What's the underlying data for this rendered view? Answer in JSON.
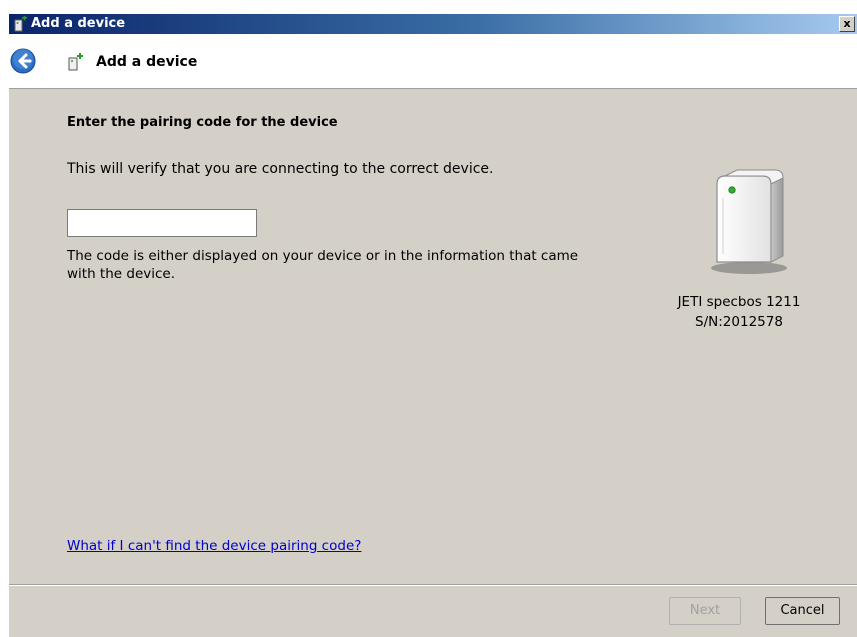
{
  "window": {
    "title": "Add a device",
    "close_label": "x"
  },
  "header": {
    "title": "Add a device"
  },
  "content": {
    "heading": "Enter the pairing code for the device",
    "description": "This will verify that you are connecting to the correct device.",
    "pairing_code_value": "",
    "hint": "The code is either displayed on your device or in the information that came with the device.",
    "help_link": "What if I can't find the device pairing code?"
  },
  "device": {
    "name": "JETI specbos 1211",
    "serial": "S/N:2012578",
    "icon": "device-tower-icon"
  },
  "buttons": {
    "next": "Next",
    "cancel": "Cancel"
  },
  "colors": {
    "link": "#0000cc",
    "dialog_bg": "#d4d0c8",
    "back_button": "#2b6cc4"
  }
}
